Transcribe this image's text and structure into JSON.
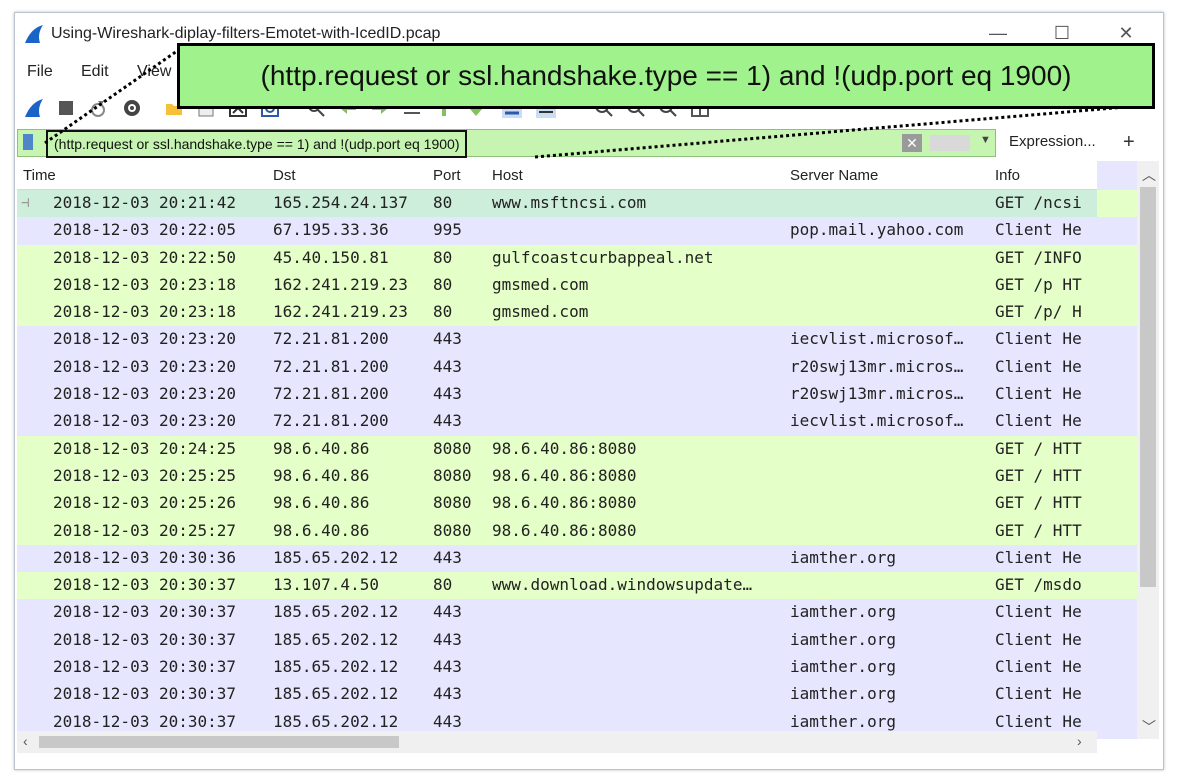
{
  "window": {
    "title": "Using-Wireshark-diplay-filters-Emotet-with-IcedID.pcap",
    "minimize": "—",
    "maximize": "☐",
    "close": "✕"
  },
  "menu": [
    "File",
    "Edit",
    "View"
  ],
  "filter": {
    "value": "(http.request or ssl.handshake.type == 1) and !(udp.port eq 1900)",
    "expression_label": "Expression...",
    "add_label": "+"
  },
  "callout": {
    "text": "(http.request or ssl.handshake.type == 1) and !(udp.port eq 1900)"
  },
  "columns": [
    "Time",
    "Dst",
    "Port",
    "Host",
    "Server Name",
    "Info"
  ],
  "rows": [
    {
      "time": "2018-12-03 20:21:42",
      "dst": "165.254.24.137",
      "port": "80",
      "host": "www.msftncsi.com",
      "server": "",
      "info": "GET /ncsi",
      "type": "selected"
    },
    {
      "time": "2018-12-03 20:22:05",
      "dst": "67.195.33.36",
      "port": "995",
      "host": "",
      "server": "pop.mail.yahoo.com",
      "info": "Client He",
      "type": "blue"
    },
    {
      "time": "2018-12-03 20:22:50",
      "dst": "45.40.150.81",
      "port": "80",
      "host": "gulfcoastcurbappeal.net",
      "server": "",
      "info": "GET /INFO",
      "type": "green"
    },
    {
      "time": "2018-12-03 20:23:18",
      "dst": "162.241.219.23",
      "port": "80",
      "host": "gmsmed.com",
      "server": "",
      "info": "GET /p HT",
      "type": "green"
    },
    {
      "time": "2018-12-03 20:23:18",
      "dst": "162.241.219.23",
      "port": "80",
      "host": "gmsmed.com",
      "server": "",
      "info": "GET /p/ H",
      "type": "green"
    },
    {
      "time": "2018-12-03 20:23:20",
      "dst": "72.21.81.200",
      "port": "443",
      "host": "",
      "server": "iecvlist.microsof…",
      "info": "Client He",
      "type": "blue"
    },
    {
      "time": "2018-12-03 20:23:20",
      "dst": "72.21.81.200",
      "port": "443",
      "host": "",
      "server": "r20swj13mr.micros…",
      "info": "Client He",
      "type": "blue"
    },
    {
      "time": "2018-12-03 20:23:20",
      "dst": "72.21.81.200",
      "port": "443",
      "host": "",
      "server": "r20swj13mr.micros…",
      "info": "Client He",
      "type": "blue"
    },
    {
      "time": "2018-12-03 20:23:20",
      "dst": "72.21.81.200",
      "port": "443",
      "host": "",
      "server": "iecvlist.microsof…",
      "info": "Client He",
      "type": "blue"
    },
    {
      "time": "2018-12-03 20:24:25",
      "dst": "98.6.40.86",
      "port": "8080",
      "host": "98.6.40.86:8080",
      "server": "",
      "info": "GET / HTT",
      "type": "green"
    },
    {
      "time": "2018-12-03 20:25:25",
      "dst": "98.6.40.86",
      "port": "8080",
      "host": "98.6.40.86:8080",
      "server": "",
      "info": "GET / HTT",
      "type": "green"
    },
    {
      "time": "2018-12-03 20:25:26",
      "dst": "98.6.40.86",
      "port": "8080",
      "host": "98.6.40.86:8080",
      "server": "",
      "info": "GET / HTT",
      "type": "green"
    },
    {
      "time": "2018-12-03 20:25:27",
      "dst": "98.6.40.86",
      "port": "8080",
      "host": "98.6.40.86:8080",
      "server": "",
      "info": "GET / HTT",
      "type": "green"
    },
    {
      "time": "2018-12-03 20:30:36",
      "dst": "185.65.202.12",
      "port": "443",
      "host": "",
      "server": "iamther.org",
      "info": "Client He",
      "type": "blue"
    },
    {
      "time": "2018-12-03 20:30:37",
      "dst": "13.107.4.50",
      "port": "80",
      "host": "www.download.windowsupdate…",
      "server": "",
      "info": "GET /msdo",
      "type": "green"
    },
    {
      "time": "2018-12-03 20:30:37",
      "dst": "185.65.202.12",
      "port": "443",
      "host": "",
      "server": "iamther.org",
      "info": "Client He",
      "type": "blue"
    },
    {
      "time": "2018-12-03 20:30:37",
      "dst": "185.65.202.12",
      "port": "443",
      "host": "",
      "server": "iamther.org",
      "info": "Client He",
      "type": "blue"
    },
    {
      "time": "2018-12-03 20:30:37",
      "dst": "185.65.202.12",
      "port": "443",
      "host": "",
      "server": "iamther.org",
      "info": "Client He",
      "type": "blue"
    },
    {
      "time": "2018-12-03 20:30:37",
      "dst": "185.65.202.12",
      "port": "443",
      "host": "",
      "server": "iamther.org",
      "info": "Client He",
      "type": "blue"
    },
    {
      "time": "2018-12-03 20:30:37",
      "dst": "185.65.202.12",
      "port": "443",
      "host": "",
      "server": "iamther.org",
      "info": "Client He",
      "type": "blue"
    }
  ],
  "colors": {
    "http_row": "#e4ffc7",
    "tls_row": "#e7e6ff",
    "selected_row": "#cdeedb",
    "filter_bg": "#c5f5b0",
    "callout_bg": "#9ff28c"
  },
  "icons": [
    "shark-fin-icon",
    "stop-icon",
    "restart-icon",
    "options-icon",
    "open-icon",
    "save-icon",
    "close-file-icon",
    "reload-icon",
    "find-icon",
    "back-icon",
    "forward-icon",
    "goto-icon",
    "first-icon",
    "last-icon",
    "autoscroll-icon",
    "colorize-icon",
    "zoom-in-icon",
    "zoom-out-icon",
    "zoom-normal-icon",
    "resize-columns-icon"
  ]
}
